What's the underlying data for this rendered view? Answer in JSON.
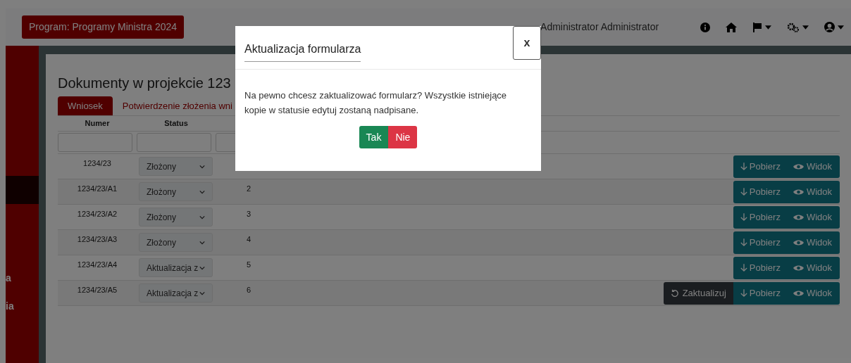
{
  "header": {
    "program": "Program: Programy Ministra 2024",
    "user": "Administrator Administrator"
  },
  "sidebar": {
    "items": [
      {
        "selected": true
      },
      {
        "label": "a",
        "selected": false
      },
      {
        "label": "ia",
        "selected": false
      }
    ]
  },
  "page": {
    "title": "Dokumenty w projekcie 123",
    "tabs": [
      {
        "label": "Wniosek",
        "selected": true
      },
      {
        "label": "Potwierdzenie złożenia wni",
        "selected": false
      }
    ],
    "table": {
      "columns": [
        "Numer",
        "Status"
      ],
      "rows": [
        {
          "numer": "1234/23",
          "status": "Złożony",
          "download": "Pobierz",
          "view": "Widok"
        },
        {
          "numer": "1234/23/A1",
          "status": "Złożony",
          "column_3": "2",
          "download": "Pobierz",
          "view": "Widok"
        },
        {
          "numer": "1234/23/A2",
          "status": "Złożony",
          "column_3": "3",
          "download": "Pobierz",
          "view": "Widok"
        },
        {
          "numer": "1234/23/A3",
          "status": "Złożony",
          "column_3": "4",
          "download": "Pobierz",
          "view": "Widok"
        },
        {
          "numer": "1234/23/A4",
          "status": "Aktualizacja z",
          "column_3": "5",
          "download": "Pobierz",
          "view": "Widok"
        },
        {
          "numer": "1234/23/A5",
          "status": "Aktualizacja z",
          "column_3": "6",
          "update": "Zaktualizuj",
          "download": "Pobierz",
          "view": "Widok"
        }
      ]
    }
  },
  "modal": {
    "title": "Aktualizacja formularza",
    "close": "x",
    "message": "Na pewno chcesz zaktualizować formularz? Wszystkie istniejące kopie w statusie edytuj zostaną nadpisane.",
    "buttons": [
      {
        "label": "Tak",
        "kind": "confirm"
      },
      {
        "label": "Nie",
        "kind": "cancel"
      }
    ]
  }
}
